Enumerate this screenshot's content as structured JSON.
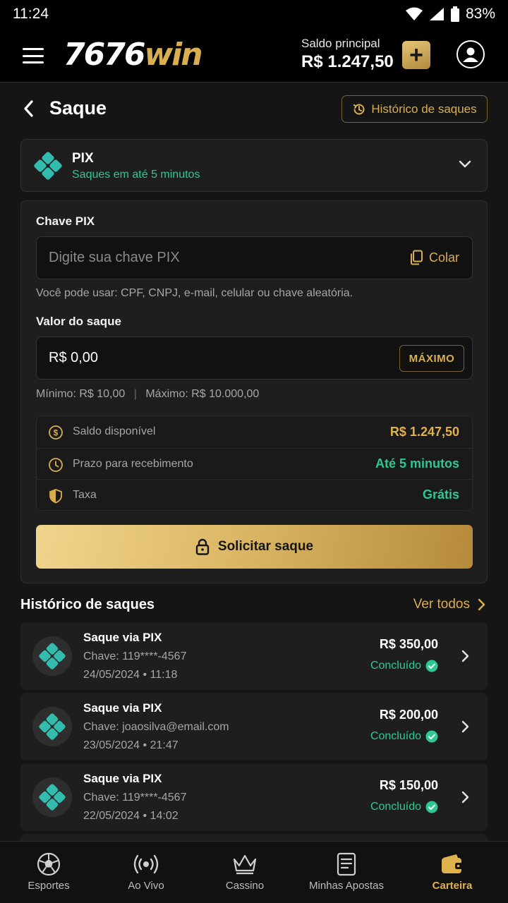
{
  "status_bar": {
    "time": "11:24",
    "battery": "83%"
  },
  "header": {
    "logo_main": "7676",
    "logo_accent": "win",
    "balance_label": "Saldo principal",
    "balance_value": "R$ 1.247,50",
    "deposit_symbol": "+"
  },
  "page": {
    "title": "Saque",
    "history_button": "Histórico de saques"
  },
  "method": {
    "name": "PIX",
    "subtitle": "Saques em até 5 minutos"
  },
  "form": {
    "pix_key_label": "Chave PIX",
    "pix_key_placeholder": "Digite sua chave PIX",
    "paste_label": "Colar",
    "pix_key_helper": "Você pode usar: CPF, CNPJ, e-mail, celular ou chave aleatória.",
    "amount_label": "Valor do saque",
    "amount_value": "R$ 0,00",
    "max_button": "MÁXIMO",
    "limits_min": "Mínimo: R$ 10,00",
    "limits_sep": "|",
    "limits_max": "Máximo: R$ 10.000,00",
    "submit_label": "Solicitar saque"
  },
  "info": [
    {
      "icon": "dollar-circle-icon",
      "label": "Saldo disponível",
      "value": "R$ 1.247,50",
      "color": "#e0b24d"
    },
    {
      "icon": "clock-icon",
      "label": "Prazo para recebimento",
      "value": "Até 5 minutos",
      "color": "#2ec892"
    },
    {
      "icon": "shield-icon",
      "label": "Taxa",
      "value": "Grátis",
      "color": "#2ec892"
    }
  ],
  "history": {
    "title": "Histórico de saques",
    "see_all": "Ver todos",
    "items": [
      {
        "title": "Saque via PIX",
        "key": "Chave: 119****-4567",
        "date": "24/05/2024 • 11:18",
        "amount": "R$ 350,00",
        "status": "Concluído"
      },
      {
        "title": "Saque via PIX",
        "key": "Chave: joaosilva@email.com",
        "date": "23/05/2024 • 21:47",
        "amount": "R$ 200,00",
        "status": "Concluído"
      },
      {
        "title": "Saque via PIX",
        "key": "Chave: 119****-4567",
        "date": "22/05/2024 • 14:02",
        "amount": "R$ 150,00",
        "status": "Concluído"
      }
    ]
  },
  "nav": [
    {
      "label": "Esportes",
      "icon": "soccer-ball-icon"
    },
    {
      "label": "Ao Vivo",
      "icon": "live-broadcast-icon"
    },
    {
      "label": "Cassino",
      "icon": "crown-icon"
    },
    {
      "label": "Minhas Apostas",
      "icon": "bet-slip-icon"
    },
    {
      "label": "Carteira",
      "icon": "wallet-icon",
      "active": true
    }
  ],
  "colors": {
    "accent_gold": "#d9ae51",
    "success_green": "#2ec892",
    "pix_teal": "#32bcad"
  }
}
